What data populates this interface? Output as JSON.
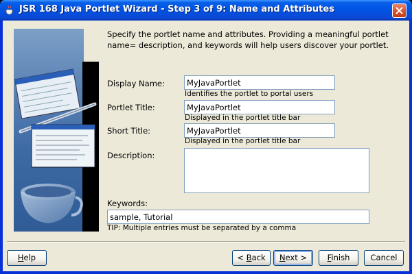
{
  "window": {
    "title": "JSR 168 Java Portlet Wizard - Step 3 of 9: Name and Attributes"
  },
  "intro": {
    "text": "Specify the portlet name and attributes. Providing a meaningful portlet name= description, and keywords will help users discover your portlet."
  },
  "form": {
    "display_name": {
      "label": "Display Name:",
      "value": "MyJavaPortlet",
      "hint": "Identifies the portlet to portal users"
    },
    "portlet_title": {
      "label": "Portlet Title:",
      "value": "MyJavaPortlet",
      "hint": "Displayed in the portlet title bar"
    },
    "short_title": {
      "label": "Short Title:",
      "value": "MyJavaPortlet",
      "hint": "Displayed in the portlet title bar"
    },
    "description": {
      "label": "Description:",
      "value": ""
    },
    "keywords": {
      "label": "Keywords:",
      "value": "sample, Tutorial",
      "tip": "TIP: Multiple entries must be separated by a comma"
    }
  },
  "buttons": {
    "help": {
      "prefix": "",
      "mnemonic": "H",
      "rest": "elp"
    },
    "back": {
      "prefix": "< ",
      "mnemonic": "B",
      "rest": "ack"
    },
    "next": {
      "prefix": "",
      "mnemonic": "N",
      "rest": "ext >"
    },
    "finish": {
      "prefix": "",
      "mnemonic": "F",
      "rest": "inish"
    },
    "cancel": {
      "label": "Cancel"
    }
  },
  "colors": {
    "titlebar": "#0055e5",
    "dialog_bg": "#ece9d8",
    "field_border": "#7f9db9",
    "close_button": "#d9542d"
  },
  "icons": {
    "title": "coffee-cup-icon",
    "close": "close-icon",
    "illustration": "java-coffee-illustration"
  }
}
